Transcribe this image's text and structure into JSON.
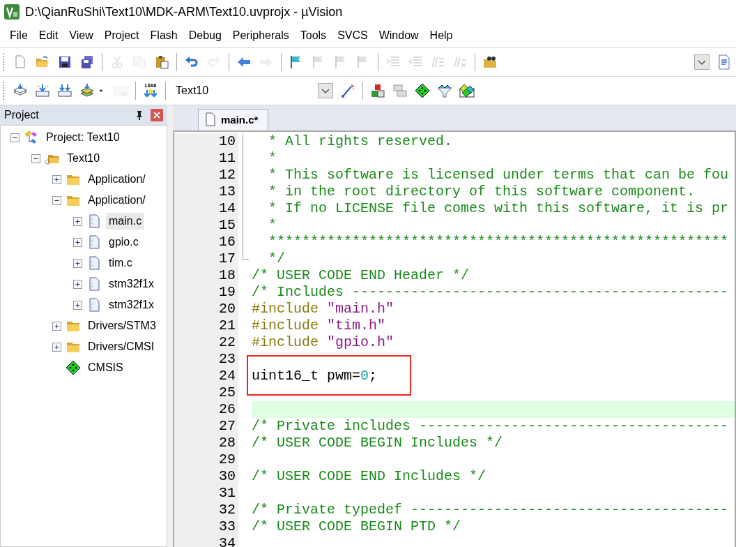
{
  "window": {
    "title": "D:\\QianRuShi\\Text10\\MDK-ARM\\Text10.uvprojx - µVision"
  },
  "menu": [
    "File",
    "Edit",
    "View",
    "Project",
    "Flash",
    "Debug",
    "Peripherals",
    "Tools",
    "SVCS",
    "Window",
    "Help"
  ],
  "toolbar_1": [
    {
      "kind": "new",
      "disabled": false
    },
    {
      "kind": "open",
      "disabled": false
    },
    {
      "kind": "save",
      "disabled": false
    },
    {
      "kind": "saveall",
      "disabled": false
    },
    {
      "kind": "sep"
    },
    {
      "kind": "cut",
      "disabled": true
    },
    {
      "kind": "copy",
      "disabled": true
    },
    {
      "kind": "paste",
      "disabled": false
    },
    {
      "kind": "sep"
    },
    {
      "kind": "undo",
      "disabled": false
    },
    {
      "kind": "redo",
      "disabled": true
    },
    {
      "kind": "sep"
    },
    {
      "kind": "back",
      "disabled": false
    },
    {
      "kind": "forward",
      "disabled": true
    },
    {
      "kind": "sep"
    },
    {
      "kind": "flag",
      "disabled": false
    },
    {
      "kind": "flag",
      "disabled": true
    },
    {
      "kind": "flag",
      "disabled": true
    },
    {
      "kind": "flag",
      "disabled": true
    },
    {
      "kind": "sep"
    },
    {
      "kind": "indent",
      "disabled": true
    },
    {
      "kind": "outdent",
      "disabled": true
    },
    {
      "kind": "comment",
      "disabled": true
    },
    {
      "kind": "uncomment",
      "disabled": true
    },
    {
      "kind": "sep"
    },
    {
      "kind": "find",
      "disabled": false
    },
    {
      "kind": "spacer"
    },
    {
      "kind": "dropdown",
      "disabled": false
    },
    {
      "kind": "doc",
      "disabled": false
    }
  ],
  "toolbar_2": [
    {
      "kind": "translate",
      "disabled": false
    },
    {
      "kind": "build",
      "disabled": false
    },
    {
      "kind": "rebuild",
      "disabled": false
    },
    {
      "kind": "batch",
      "disabled": false
    },
    {
      "kind": "caret",
      "disabled": false
    },
    {
      "kind": "stop",
      "disabled": true
    },
    {
      "kind": "sep"
    },
    {
      "kind": "load",
      "label": "LOAD",
      "disabled": false
    },
    {
      "kind": "sep"
    },
    {
      "kind": "target",
      "value": "Text10"
    },
    {
      "kind": "wand",
      "disabled": false
    },
    {
      "kind": "sep"
    },
    {
      "kind": "blocks",
      "disabled": false
    },
    {
      "kind": "windows",
      "disabled": false
    },
    {
      "kind": "diamond",
      "disabled": false
    },
    {
      "kind": "funnel",
      "disabled": false
    },
    {
      "kind": "diamonds",
      "disabled": false
    }
  ],
  "project_panel": {
    "title": "Project",
    "tree": [
      {
        "label": "Project: Text10",
        "kind": "project",
        "expanded": true,
        "selected": false,
        "children": [
          {
            "label": "Text10",
            "kind": "target",
            "expanded": true,
            "selected": false,
            "children": [
              {
                "label": "Application/",
                "kind": "folder",
                "expanded": false,
                "selected": false
              },
              {
                "label": "Application/",
                "kind": "folder",
                "expanded": true,
                "selected": false,
                "children": [
                  {
                    "label": "main.c",
                    "kind": "file",
                    "expanded": false,
                    "selected": true
                  },
                  {
                    "label": "gpio.c",
                    "kind": "file",
                    "expanded": false,
                    "selected": false
                  },
                  {
                    "label": "tim.c",
                    "kind": "file",
                    "expanded": false,
                    "selected": false
                  },
                  {
                    "label": "stm32f1x",
                    "kind": "file",
                    "expanded": false,
                    "selected": false
                  },
                  {
                    "label": "stm32f1x",
                    "kind": "file",
                    "expanded": false,
                    "selected": false
                  }
                ]
              },
              {
                "label": "Drivers/STM3",
                "kind": "folder",
                "expanded": false,
                "selected": false
              },
              {
                "label": "Drivers/CMSI",
                "kind": "folder",
                "expanded": false,
                "selected": false
              },
              {
                "label": "CMSIS",
                "kind": "component",
                "selected": false
              }
            ]
          }
        ]
      }
    ]
  },
  "editor": {
    "tabs": [
      {
        "label": "main.c*",
        "selected": true
      }
    ],
    "lines": [
      {
        "number": "10",
        "in_fold": true,
        "current": false,
        "tokens": [
          {
            "kind": "comment",
            "text": "  * All rights reserved."
          }
        ]
      },
      {
        "number": "11",
        "in_fold": true,
        "current": false,
        "tokens": [
          {
            "kind": "comment",
            "text": "  *"
          }
        ]
      },
      {
        "number": "12",
        "in_fold": true,
        "current": false,
        "tokens": [
          {
            "kind": "comment",
            "text": "  * This software is licensed under terms that can be fou"
          }
        ]
      },
      {
        "number": "13",
        "in_fold": true,
        "current": false,
        "tokens": [
          {
            "kind": "comment",
            "text": "  * in the root directory of this software component."
          }
        ]
      },
      {
        "number": "14",
        "in_fold": true,
        "current": false,
        "tokens": [
          {
            "kind": "comment",
            "text": "  * If no LICENSE file comes with this software, it is pr"
          }
        ]
      },
      {
        "number": "15",
        "in_fold": true,
        "current": false,
        "tokens": [
          {
            "kind": "comment",
            "text": "  *"
          }
        ]
      },
      {
        "number": "16",
        "in_fold": true,
        "current": false,
        "tokens": [
          {
            "kind": "comment",
            "text": "  *******************************************************"
          }
        ]
      },
      {
        "number": "17",
        "in_fold": true,
        "current": false,
        "tokens": [
          {
            "kind": "comment",
            "text": "  */"
          }
        ]
      },
      {
        "number": "18",
        "in_fold": false,
        "current": false,
        "tokens": [
          {
            "kind": "comment",
            "text": "/* USER CODE END Header */"
          }
        ]
      },
      {
        "number": "19",
        "in_fold": false,
        "current": false,
        "tokens": [
          {
            "kind": "comment",
            "text": "/* Includes ---------------------------------------------"
          }
        ]
      },
      {
        "number": "20",
        "in_fold": false,
        "current": false,
        "tokens": [
          {
            "kind": "preproc",
            "text": "#include "
          },
          {
            "kind": "string",
            "text": "\"main.h\""
          }
        ]
      },
      {
        "number": "21",
        "in_fold": false,
        "current": false,
        "tokens": [
          {
            "kind": "preproc",
            "text": "#include "
          },
          {
            "kind": "string",
            "text": "\"tim.h\""
          }
        ]
      },
      {
        "number": "22",
        "in_fold": false,
        "current": false,
        "tokens": [
          {
            "kind": "preproc",
            "text": "#include "
          },
          {
            "kind": "string",
            "text": "\"gpio.h\""
          }
        ]
      },
      {
        "number": "23",
        "in_fold": false,
        "current": false
      },
      {
        "number": "24",
        "in_fold": false,
        "current": false,
        "tokens": [
          {
            "kind": "plain",
            "text": "uint16_t pwm="
          },
          {
            "kind": "number",
            "text": "0"
          },
          {
            "kind": "plain",
            "text": ";"
          }
        ]
      },
      {
        "number": "25",
        "in_fold": false,
        "current": false
      },
      {
        "number": "26",
        "in_fold": false,
        "current": true
      },
      {
        "number": "27",
        "in_fold": false,
        "current": false,
        "tokens": [
          {
            "kind": "comment",
            "text": "/* Private includes -------------------------------------"
          }
        ]
      },
      {
        "number": "28",
        "in_fold": false,
        "current": false,
        "tokens": [
          {
            "kind": "comment",
            "text": "/* USER CODE BEGIN Includes */"
          }
        ]
      },
      {
        "number": "29",
        "in_fold": false,
        "current": false
      },
      {
        "number": "30",
        "in_fold": false,
        "current": false,
        "tokens": [
          {
            "kind": "comment",
            "text": "/* USER CODE END Includes */"
          }
        ]
      },
      {
        "number": "31",
        "in_fold": false,
        "current": false
      },
      {
        "number": "32",
        "in_fold": false,
        "current": false,
        "tokens": [
          {
            "kind": "comment",
            "text": "/* Private typedef --------------------------------------"
          }
        ]
      },
      {
        "number": "33",
        "in_fold": false,
        "current": false,
        "tokens": [
          {
            "kind": "comment",
            "text": "/* USER CODE BEGIN PTD */"
          }
        ]
      },
      {
        "number": "34",
        "in_fold": false,
        "current": false
      }
    ]
  }
}
